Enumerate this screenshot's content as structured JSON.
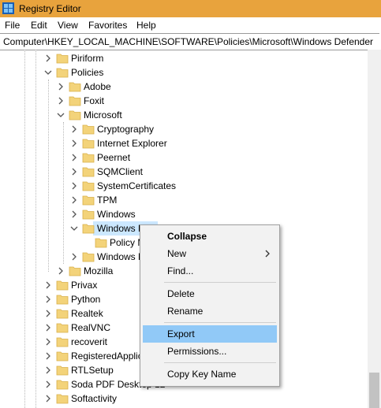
{
  "window": {
    "title": "Registry Editor"
  },
  "menu": {
    "items": [
      "File",
      "Edit",
      "View",
      "Favorites",
      "Help"
    ]
  },
  "address": {
    "path": "Computer\\HKEY_LOCAL_MACHINE\\SOFTWARE\\Policies\\Microsoft\\Windows Defender"
  },
  "tree": {
    "rows": [
      {
        "label": "Piriform",
        "expanded": false
      },
      {
        "label": "Policies",
        "expanded": true
      },
      {
        "label": "Adobe",
        "expanded": false
      },
      {
        "label": "Foxit",
        "expanded": false
      },
      {
        "label": "Microsoft",
        "expanded": true
      },
      {
        "label": "Cryptography",
        "expanded": false
      },
      {
        "label": "Internet Explorer",
        "expanded": false
      },
      {
        "label": "Peernet",
        "expanded": false
      },
      {
        "label": "SQMClient",
        "expanded": false
      },
      {
        "label": "SystemCertificates",
        "expanded": false
      },
      {
        "label": "TPM",
        "expanded": false
      },
      {
        "label": "Windows",
        "expanded": false
      },
      {
        "label": "Windows D",
        "expanded": true,
        "selected": true
      },
      {
        "label": "Policy M",
        "expanded": false
      },
      {
        "label": "Windows N",
        "expanded": false
      },
      {
        "label": "Mozilla",
        "expanded": false
      },
      {
        "label": "Privax",
        "expanded": false
      },
      {
        "label": "Python",
        "expanded": false
      },
      {
        "label": "Realtek",
        "expanded": false
      },
      {
        "label": "RealVNC",
        "expanded": false
      },
      {
        "label": "recoverit",
        "expanded": false
      },
      {
        "label": "RegisteredApplic",
        "expanded": false
      },
      {
        "label": "RTLSetup",
        "expanded": false
      },
      {
        "label": "Soda PDF Desktop 12",
        "expanded": false
      },
      {
        "label": "Softactivity",
        "expanded": false
      }
    ]
  },
  "context_menu": {
    "collapse": "Collapse",
    "new": "New",
    "find": "Find...",
    "delete": "Delete",
    "rename": "Rename",
    "export": "Export",
    "permissions": "Permissions...",
    "copy_key_name": "Copy Key Name",
    "highlighted": "Export"
  },
  "colors": {
    "titlebar": "#e8a33d",
    "folder": "#f3d37a",
    "selection": "#cce8ff",
    "menu_highlight": "#91c9f7"
  },
  "icons": {
    "app": "registry-editor-icon",
    "folder": "folder-icon",
    "expanded": "chevron-down-icon",
    "collapsed": "chevron-right-icon",
    "submenu": "chevron-right-icon"
  }
}
